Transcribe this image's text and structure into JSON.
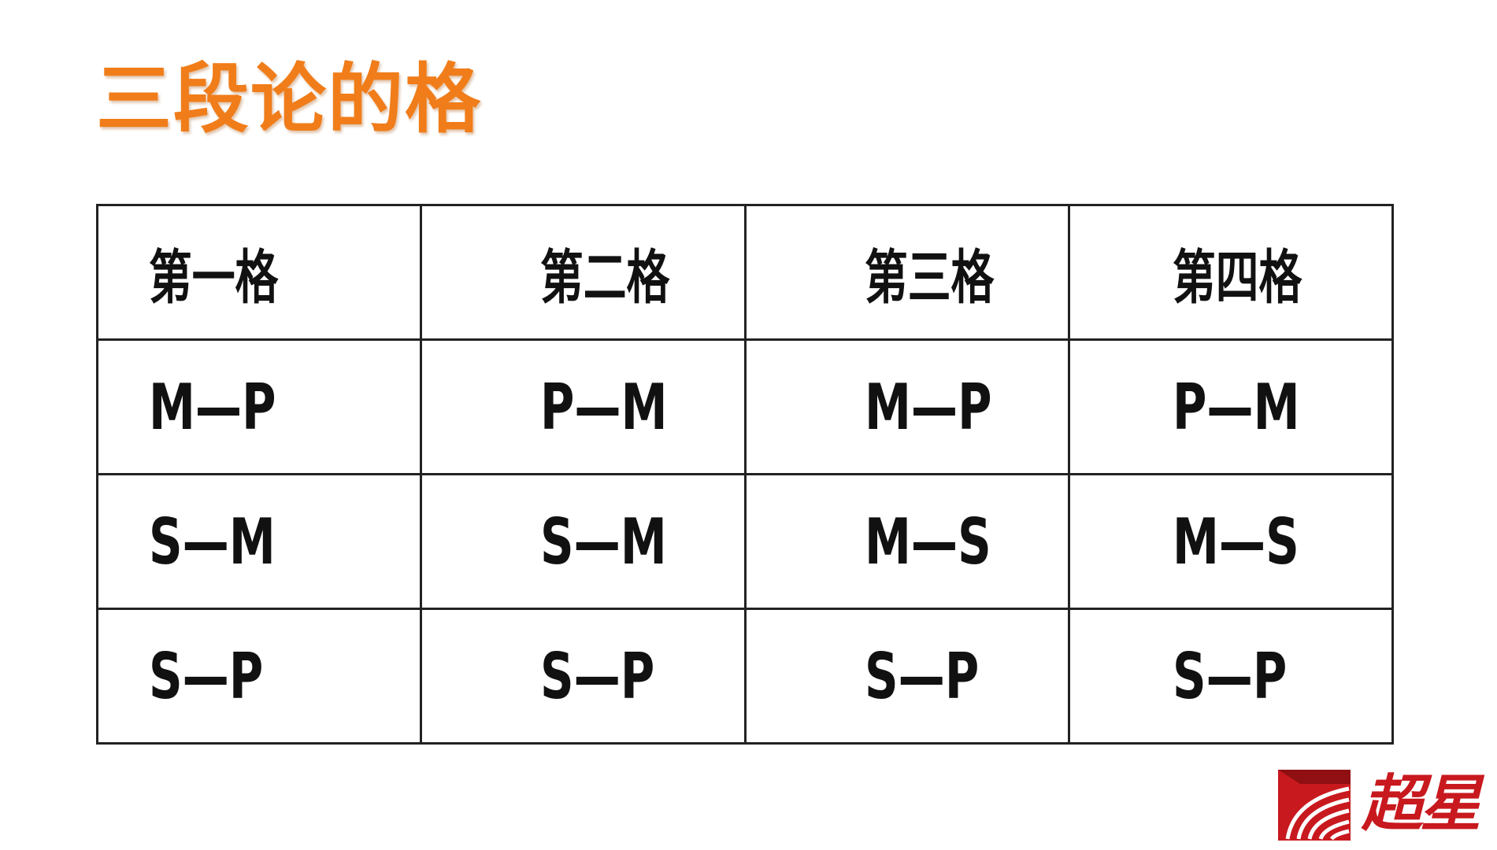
{
  "title": "三段论的格",
  "table": {
    "headers": [
      "第一格",
      "第二格",
      "第三格",
      "第四格"
    ],
    "rows": [
      [
        "M—P",
        "P—M",
        "M—P",
        "P—M"
      ],
      [
        "S—M",
        "S—M",
        "M—S",
        "M—S"
      ],
      [
        "S—P",
        "S—P",
        "S—P",
        "S—P"
      ]
    ]
  },
  "logo": {
    "text": "超星",
    "icon": "chaoxing-logo-icon",
    "color": "#c8191e"
  },
  "colors": {
    "title": "#f07d1a",
    "border": "#222222",
    "text": "#111111"
  }
}
